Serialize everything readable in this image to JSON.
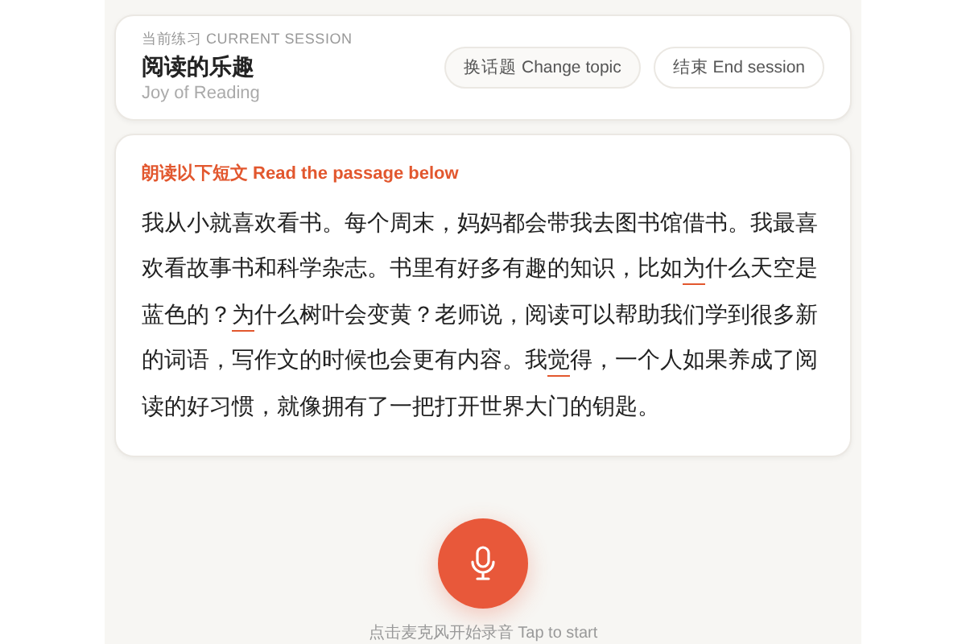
{
  "session": {
    "label": "当前练习 CURRENT SESSION",
    "title": "阅读的乐趣",
    "subtitle": "Joy of Reading"
  },
  "buttons": [
    {
      "label": "换话题 Change topic"
    },
    {
      "label": "结束 End session"
    }
  ],
  "passage": {
    "instruction": "朗读以下短文 Read the passage below",
    "segments": [
      {
        "text": "我从小就喜欢看书。每个周末，妈妈都会带我去图书馆借书。我最喜欢看故事书和科学杂志。书里有好多有趣的知识，比如",
        "flagged": false
      },
      {
        "text": "为",
        "flagged": true
      },
      {
        "text": "什么天空是蓝色的？",
        "flagged": false
      },
      {
        "text": "为",
        "flagged": true
      },
      {
        "text": "什么树叶会变黄？老师说，阅读可以帮助我们学到很多新的词语，写作文的时候也会更有内容。我",
        "flagged": false
      },
      {
        "text": "觉",
        "flagged": true
      },
      {
        "text": "得，一个人如果养成了阅读的好习惯，就像拥有了一把打开世界大门的钥匙。",
        "flagged": false
      }
    ]
  },
  "recorder": {
    "recording": false,
    "hint": "点击麦克风开始录音 Tap to start"
  }
}
